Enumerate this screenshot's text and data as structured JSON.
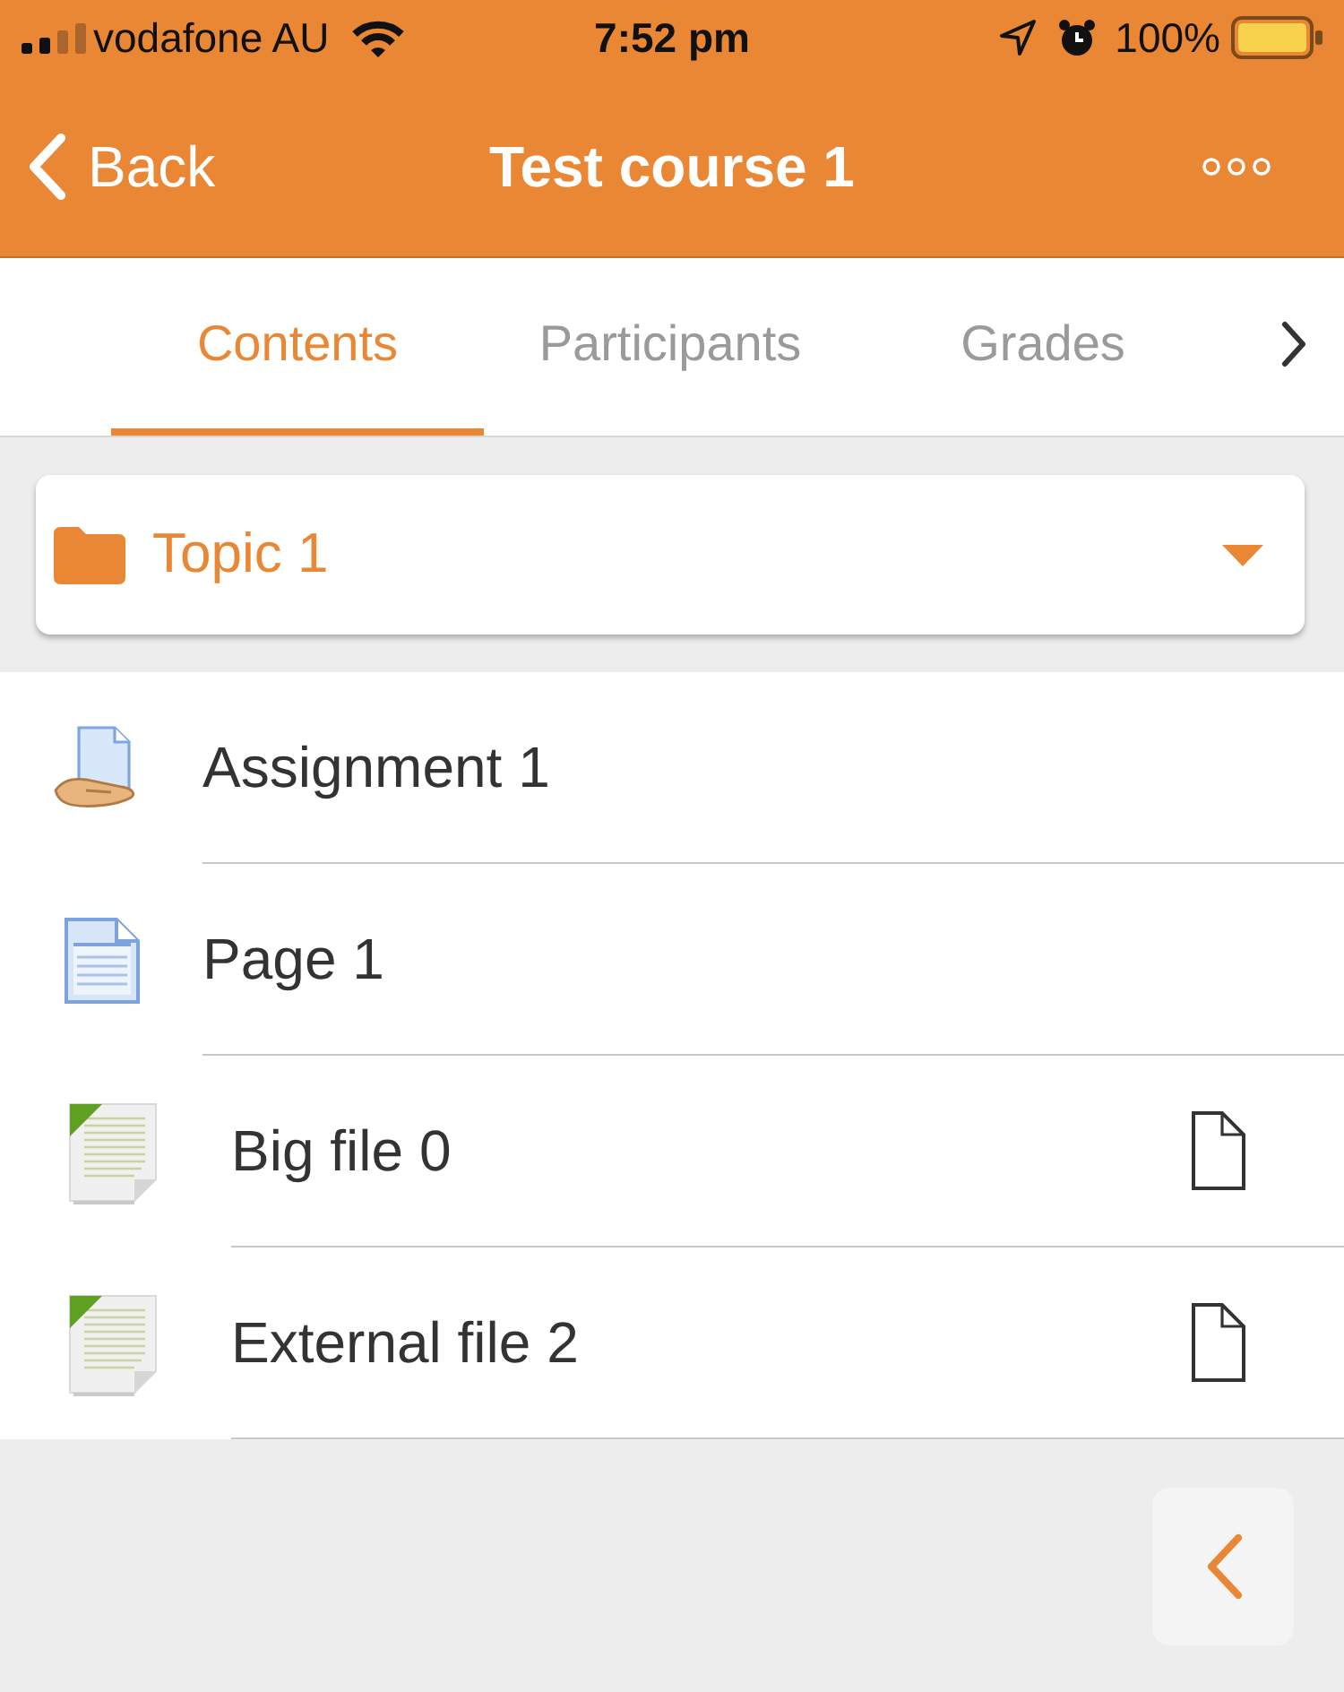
{
  "status_bar": {
    "carrier": "vodafone AU",
    "time": "7:52 pm",
    "battery": "100%"
  },
  "header": {
    "back": "Back",
    "title": "Test course 1"
  },
  "tabs": [
    {
      "label": "Contents",
      "selected": true
    },
    {
      "label": "Participants",
      "selected": false
    },
    {
      "label": "Grades",
      "selected": false
    }
  ],
  "section_selector": {
    "label": "Topic 1"
  },
  "modules": [
    {
      "kind": "assignment",
      "name": "Assignment 1"
    },
    {
      "kind": "page",
      "name": "Page 1"
    },
    {
      "kind": "file",
      "name": "Big file 0"
    },
    {
      "kind": "file",
      "name": "External file 2"
    }
  ]
}
